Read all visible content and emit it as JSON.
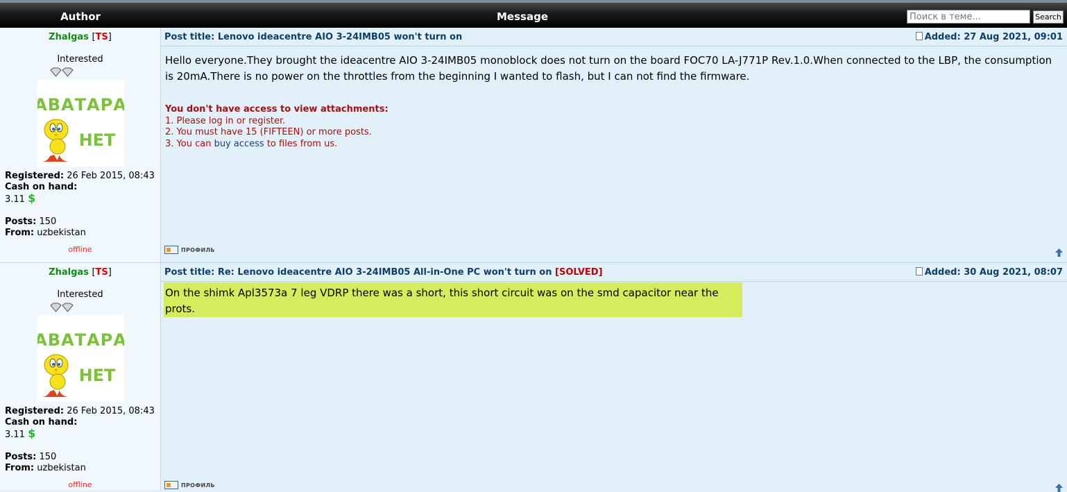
{
  "header": {
    "author_label": "Author",
    "message_label": "Message",
    "search_placeholder": "Поиск в теме...",
    "search_button": "Search"
  },
  "posts": [
    {
      "username": "Zhalgas",
      "ts_label": "TS",
      "rank": "Interested",
      "avatar_text_line1": "АВАТАРА",
      "avatar_text_line2": "НЕТ",
      "registered_label": "Registered:",
      "registered_value": "26 Feb 2015, 08:43",
      "cash_label": "Cash on hand:",
      "cash_value": "3.11",
      "currency": "$",
      "posts_label": "Posts:",
      "posts_value": "150",
      "from_label": "From:",
      "from_value": "uzbekistan",
      "status": "offline",
      "title": "Post title: Lenovo ideacentre AIO 3-24IMB05 won't turn on",
      "added": "Added: 27 Aug 2021, 09:01",
      "body": "Hello everyone.They brought the ideacentre AIO 3-24IMB05 monoblock does not turn on the board FOC70 LA-J771P Rev.1.0.When connected to the LBP, the consumption is 20mA.There is no power on the throttles from the beginning I wanted to flash, but I can not find the firmware.",
      "noaccess_title": "You don't have access to view attachments:",
      "noaccess_1": "1. Please log in or register.",
      "noaccess_2": "2. You must have 15 (FIFTEEN) or more posts.",
      "noaccess_3_pre": "3. You can ",
      "noaccess_3_link": "buy access",
      "noaccess_3_post": " to files from us.",
      "profile_label": "ПРОФИЛЬ"
    },
    {
      "username": "Zhalgas",
      "ts_label": "TS",
      "rank": "Interested",
      "avatar_text_line1": "АВАТАРА",
      "avatar_text_line2": "НЕТ",
      "registered_label": "Registered:",
      "registered_value": "26 Feb 2015, 08:43",
      "cash_label": "Cash on hand:",
      "cash_value": "3.11",
      "currency": "$",
      "posts_label": "Posts:",
      "posts_value": "150",
      "from_label": "From:",
      "from_value": "uzbekistan",
      "status": "offline",
      "title": "Post title: Re: Lenovo ideacentre AIO 3-24IMB05 All-in-One PC won't turn on",
      "title_suffix": "[SOLVED]",
      "added": "Added: 30 Aug 2021, 08:07",
      "body": "On the shimk Apl3573a 7 leg VDRP there was a short, this short circuit was on the smd capacitor near the prots.",
      "profile_label": "ПРОФИЛЬ"
    }
  ]
}
